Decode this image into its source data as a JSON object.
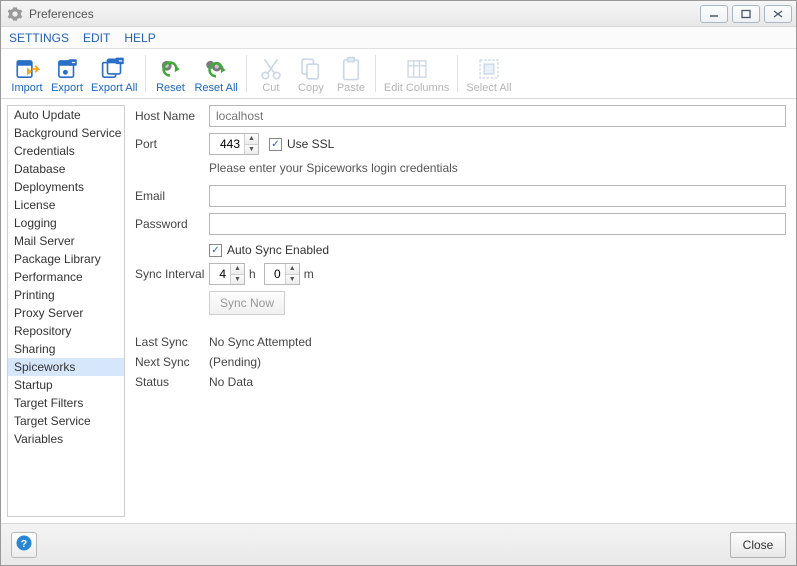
{
  "window": {
    "title": "Preferences"
  },
  "menu": {
    "settings": "SETTINGS",
    "edit": "EDIT",
    "help": "HELP"
  },
  "toolbar": {
    "import": "Import",
    "export": "Export",
    "export_all": "Export All",
    "reset": "Reset",
    "reset_all": "Reset All",
    "cut": "Cut",
    "copy": "Copy",
    "paste": "Paste",
    "edit_columns": "Edit Columns",
    "select_all": "Select All"
  },
  "sidebar": {
    "items": [
      "Auto Update",
      "Background Service",
      "Credentials",
      "Database",
      "Deployments",
      "License",
      "Logging",
      "Mail Server",
      "Package Library",
      "Performance",
      "Printing",
      "Proxy Server",
      "Repository",
      "Sharing",
      "Spiceworks",
      "Startup",
      "Target Filters",
      "Target Service",
      "Variables"
    ],
    "selected_index": 14
  },
  "form": {
    "host_label": "Host Name",
    "host_placeholder": "localhost",
    "port_label": "Port",
    "port_value": "443",
    "use_ssl_label": "Use SSL",
    "use_ssl_checked": true,
    "hint": "Please enter your Spiceworks login credentials",
    "email_label": "Email",
    "password_label": "Password",
    "autosync_label": "Auto Sync Enabled",
    "autosync_checked": true,
    "interval_label": "Sync Interval",
    "interval_h": "4",
    "interval_m": "0",
    "unit_h": "h",
    "unit_m": "m",
    "sync_now": "Sync Now",
    "last_sync_label": "Last Sync",
    "last_sync_value": "No Sync Attempted",
    "next_sync_label": "Next Sync",
    "next_sync_value": "(Pending)",
    "status_label": "Status",
    "status_value": "No Data"
  },
  "footer": {
    "close": "Close"
  }
}
